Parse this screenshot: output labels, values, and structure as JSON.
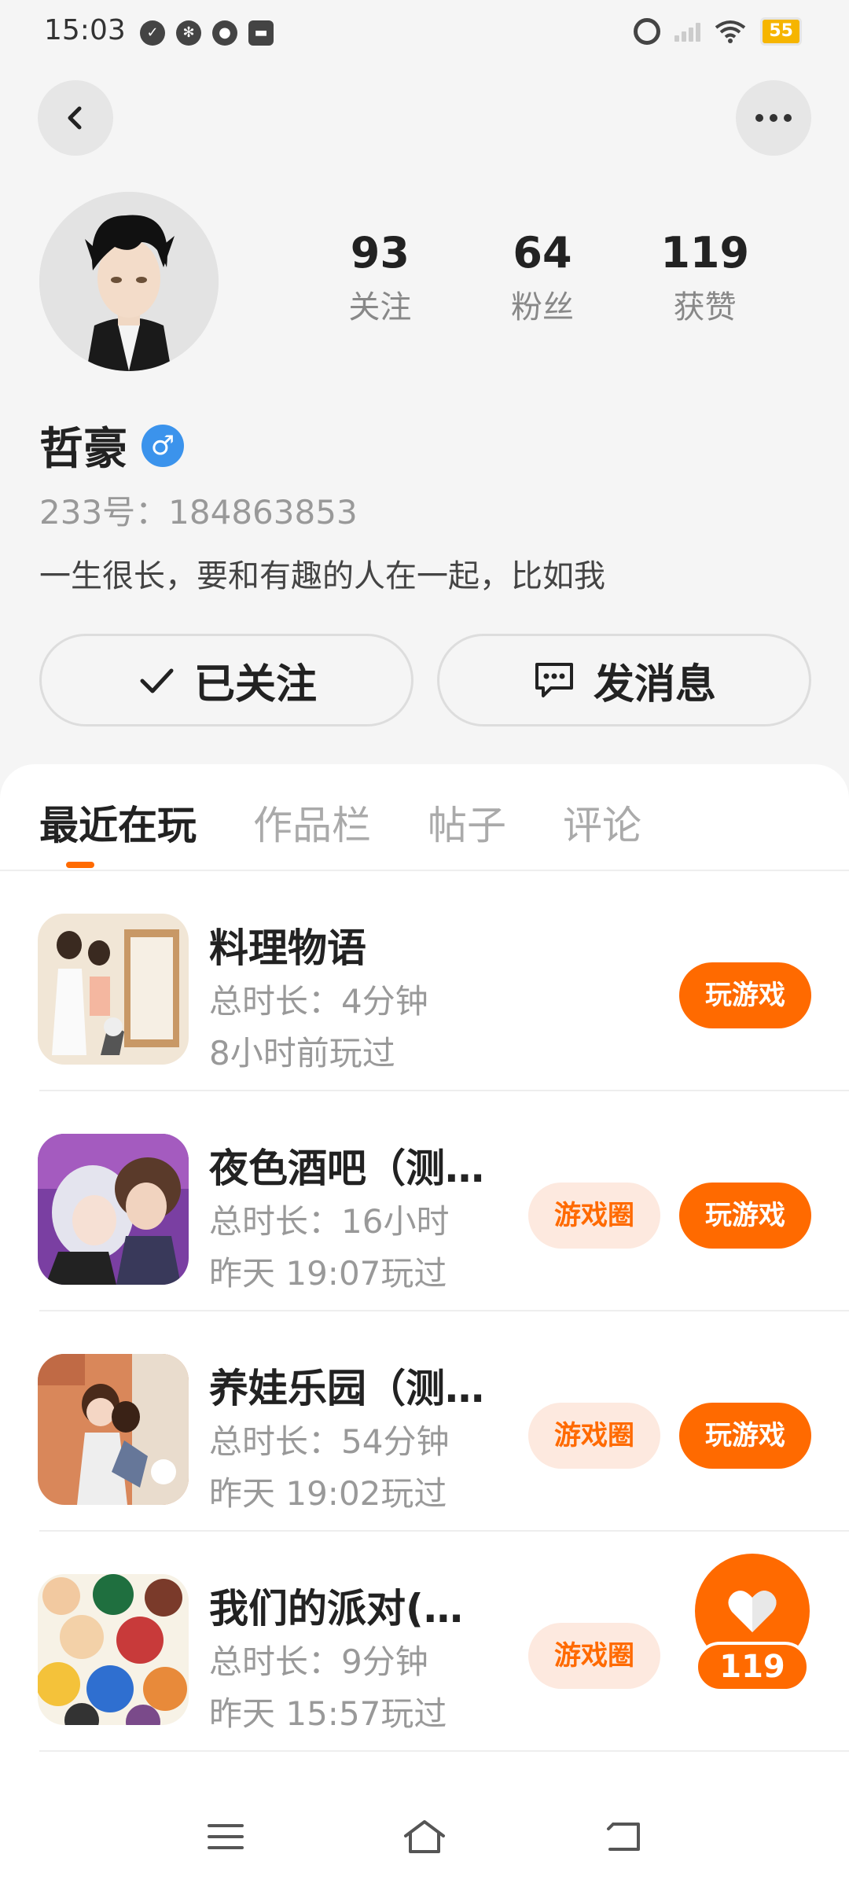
{
  "status_bar": {
    "time": "15:03",
    "battery": "55"
  },
  "profile": {
    "stats": [
      {
        "value": "93",
        "label": "关注"
      },
      {
        "value": "64",
        "label": "粉丝"
      },
      {
        "value": "119",
        "label": "获赞"
      }
    ],
    "name": "哲豪",
    "gender_symbol": "♂",
    "uid": "233号：184863853",
    "bio": "一生很长，要和有趣的人在一起，比如我",
    "follow_label": "已关注",
    "message_label": "发消息"
  },
  "tabs": [
    {
      "label": "最近在玩"
    },
    {
      "label": "作品栏"
    },
    {
      "label": "帖子"
    },
    {
      "label": "评论"
    }
  ],
  "games": [
    {
      "title": "料理物语",
      "duration": "总时长：4分钟",
      "last_played": "8小时前玩过",
      "play_label": "玩游戏"
    },
    {
      "title": "夜色酒吧（测…",
      "duration": "总时长：16小时",
      "last_played": "昨天 19:07玩过",
      "circle_label": "游戏圈",
      "play_label": "玩游戏"
    },
    {
      "title": "养娃乐园（测…",
      "duration": "总时长：54分钟",
      "last_played": "昨天 19:02玩过",
      "circle_label": "游戏圈",
      "play_label": "玩游戏"
    },
    {
      "title": "我们的派对(…",
      "duration": "总时长：9分钟",
      "last_played": "昨天 15:57玩过",
      "circle_label": "游戏圈"
    }
  ],
  "like_fab": {
    "count": "119"
  },
  "colors": {
    "accent": "#ff6a00",
    "accent_light": "#fde9df",
    "gender_blue": "#3b93ec"
  }
}
